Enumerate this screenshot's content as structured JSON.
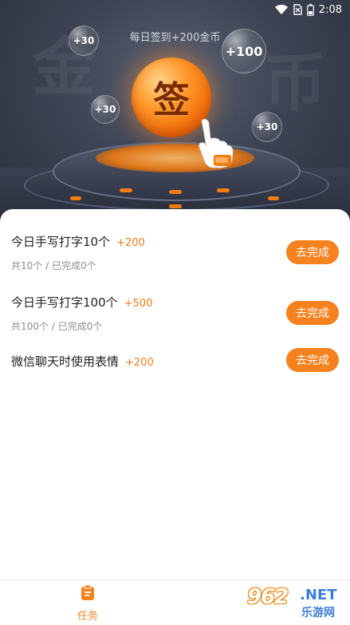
{
  "status_bar": {
    "time": "2:08"
  },
  "hero": {
    "title": "每日签到+200金币",
    "sign_label": "签",
    "bubbles": [
      "+30",
      "+100",
      "+30",
      "+30"
    ]
  },
  "tasks": [
    {
      "title": "今日手写打字10个",
      "reward": "+200",
      "progress": "共10个 / 已完成0个",
      "button": "去完成"
    },
    {
      "title": "今日手写打字100个",
      "reward": "+500",
      "progress": "共100个 / 已完成0个",
      "button": "去完成"
    },
    {
      "title": "微信聊天时使用表情",
      "reward": "+200",
      "progress": "",
      "button": "去完成"
    }
  ],
  "bottom_nav": {
    "tabs": [
      {
        "label": "任务",
        "icon": "task-icon",
        "active": true
      }
    ]
  },
  "watermark": {
    "number": "962",
    "net": ".NET",
    "site": "乐游网"
  },
  "colors": {
    "accent": "#f5821f",
    "reward": "#f07a1a",
    "hero_bg": "#3e4453"
  }
}
